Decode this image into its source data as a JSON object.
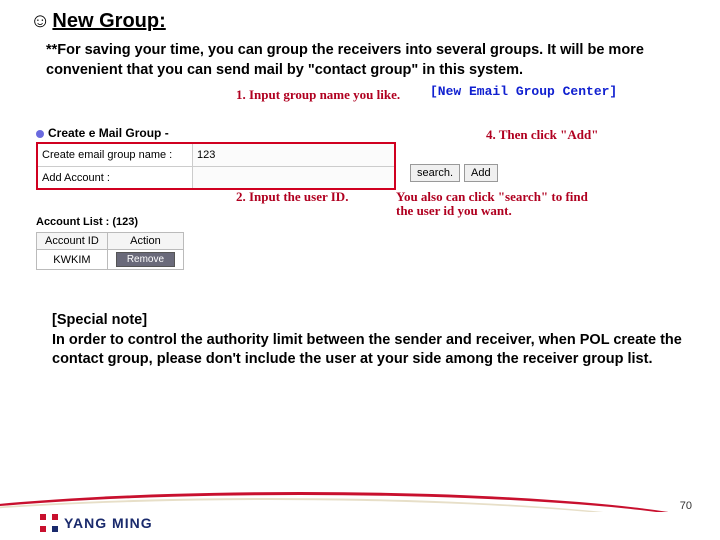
{
  "title": "New Group:",
  "intro": "**For saving your time, you can group the receivers into several groups. It will be more convenient that you can send mail by \"contact group\" in this system.",
  "center_label": "[New Email Group Center]",
  "annotations": {
    "step1": "1. Input group name you like.",
    "step2": "2. Input the user ID.",
    "step3": "You also can click \"search\" to find the user id you want.",
    "step4": "4. Then click \"Add\""
  },
  "form": {
    "section_header": "Create e Mail Group -",
    "row1_label": "Create email group name :",
    "row1_value": "123",
    "row2_label": "Add Account :",
    "row2_value": "",
    "search_btn": "search.",
    "add_btn": "Add",
    "list_header": "Account List : (123)",
    "table": {
      "cols": [
        "Account ID",
        "Action"
      ],
      "row": {
        "id": "KWKIM",
        "action": "Remove"
      }
    }
  },
  "special_note_label": "[Special note]",
  "special_note_body": "In order to control the authority limit between the sender and receiver, when POL create the contact group, please don't include the user at your side among the receiver group list.",
  "brand": "YANG MING",
  "page_number": "70"
}
